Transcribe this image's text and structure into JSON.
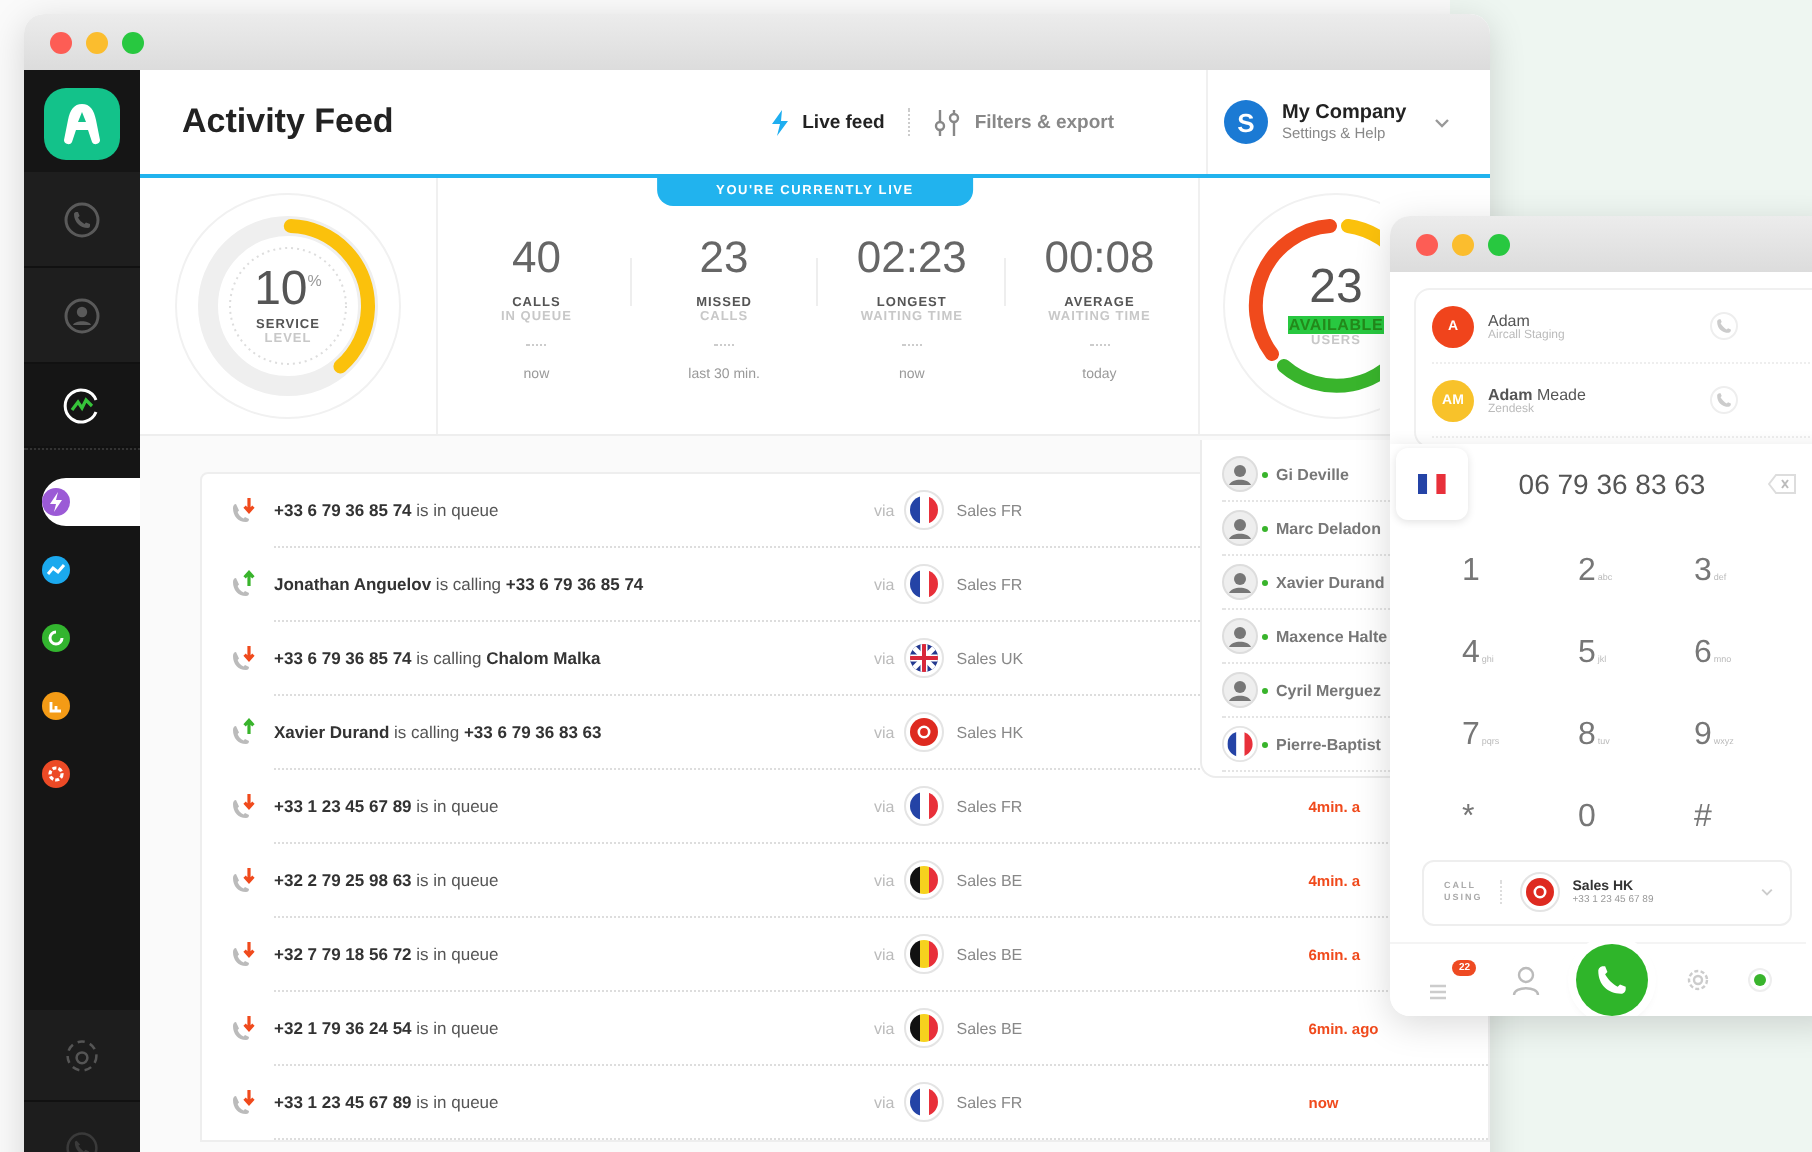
{
  "sidebar": {
    "nav": [
      {
        "kind": "phone",
        "selected": false
      },
      {
        "kind": "person",
        "selected": false
      },
      {
        "kind": "activity",
        "selected": true
      }
    ],
    "sub_items": [
      {
        "kind": "bolt",
        "color": "#9b5ad6",
        "selected": true
      },
      {
        "kind": "trend",
        "color": "#1ba9ee",
        "selected": false
      },
      {
        "kind": "refresh",
        "color": "#33b52f",
        "selected": false
      },
      {
        "kind": "chart",
        "color": "#f49b16",
        "selected": false
      },
      {
        "kind": "gear",
        "color": "#ec4a26",
        "selected": false
      }
    ]
  },
  "header": {
    "title": "Activity Feed",
    "tabs": [
      {
        "kind": "live",
        "label": "Live feed",
        "selected": true
      },
      {
        "kind": "filters",
        "label": "Filters & export",
        "selected": false
      }
    ],
    "account": {
      "initial": "S",
      "name": "My Company",
      "subtitle": "Settings & Help"
    }
  },
  "live_banner": "YOU'RE CURRENTLY LIVE",
  "service_level": {
    "value": "10",
    "unit": "%",
    "label_1": "SERVICE",
    "label_2": "LEVEL",
    "level": 0.38
  },
  "stats": [
    {
      "value": "40",
      "label_1": "CALLS",
      "label_2": "IN QUEUE",
      "period": "now"
    },
    {
      "value": "23",
      "label_1": "MISSED",
      "label_2": "CALLS",
      "period": "last 30 min."
    },
    {
      "value": "02:23",
      "label_1": "LONGEST",
      "label_2": "WAITING TIME",
      "period": "now"
    },
    {
      "value": "00:08",
      "label_1": "AVERAGE",
      "label_2": "WAITING TIME",
      "period": "today"
    }
  ],
  "availability": {
    "value": "23",
    "label_1": "AVAILABLE",
    "label_2": "USERS"
  },
  "feed": {
    "rows": [
      {
        "kind": "incoming",
        "text": "**+33 6 79 36 85 74** is in queue",
        "via": "via",
        "flag": {
          "kind": "fr"
        },
        "team": "Sales FR"
      },
      {
        "kind": "outgoing",
        "text": "**Jonathan Anguelov** is calling **+33 6 79 36 85 74**",
        "via": "via",
        "flag": {
          "kind": "fr"
        },
        "team": "Sales FR"
      },
      {
        "kind": "incoming",
        "text": "**+33 6 79 36 85 74** is calling **Chalom Malka**",
        "via": "via",
        "flag": {
          "kind": "uk"
        },
        "team": "Sales UK"
      },
      {
        "kind": "outgoing",
        "text": "**Xavier Durand** is calling **+33 6 79 36 83 63**",
        "via": "via",
        "flag": {
          "kind": "hk"
        },
        "team": "Sales HK"
      },
      {
        "kind": "incoming",
        "text": "**+33 1 23 45 67 89** is in queue",
        "via": "via",
        "flag": {
          "kind": "fr"
        },
        "team": "Sales FR",
        "time": "4min. a"
      },
      {
        "kind": "incoming",
        "text": "**+32 2 79 25 98 63** is in queue",
        "via": "via",
        "flag": {
          "kind": "be"
        },
        "team": "Sales BE",
        "time": "4min. a"
      },
      {
        "kind": "incoming",
        "text": "**+32 7 79 18 56 72** is in queue",
        "via": "via",
        "flag": {
          "kind": "be"
        },
        "team": "Sales BE",
        "time": "6min. a"
      },
      {
        "kind": "incoming",
        "text": "**+32 1 79 36 24 54** is in queue",
        "via": "via",
        "flag": {
          "kind": "be"
        },
        "team": "Sales BE",
        "time": "6min. ago"
      },
      {
        "kind": "incoming",
        "text": "**+33 1 23 45 67 89** is in queue",
        "via": "via",
        "flag": {
          "kind": "fr"
        },
        "team": "Sales FR",
        "time": "now"
      }
    ]
  },
  "users": [
    {
      "name": "Gi Deville",
      "kind": "person"
    },
    {
      "name": "Marc Deladon",
      "kind": "person"
    },
    {
      "name": "Xavier Durand",
      "kind": "person"
    },
    {
      "name": "Maxence Halte",
      "kind": "person"
    },
    {
      "name": "Cyril Merguez",
      "kind": "person"
    },
    {
      "name": "Pierre-Baptist",
      "kind": "flag"
    }
  ],
  "dialer": {
    "contacts": [
      {
        "initials": "A",
        "color": "#f0441c",
        "name": "Adam",
        "company": "Aircall Staging"
      },
      {
        "initials": "AM",
        "color": "#f8c22a",
        "name": "**Adam** Meade",
        "company": "Zendesk"
      }
    ],
    "flag": {
      "kind": "fr"
    },
    "number": "06 79 36 83 63",
    "keys": [
      {
        "digit": "1"
      },
      {
        "digit": "2",
        "letters": "abc"
      },
      {
        "digit": "3",
        "letters": "def"
      },
      {
        "digit": "4",
        "letters": "ghi"
      },
      {
        "digit": "5",
        "letters": "jkl"
      },
      {
        "digit": "6",
        "letters": "mno"
      },
      {
        "digit": "7",
        "letters": "pqrs"
      },
      {
        "digit": "8",
        "letters": "tuv"
      },
      {
        "digit": "9",
        "letters": "wxyz"
      },
      {
        "digit": "*"
      },
      {
        "digit": "0"
      },
      {
        "digit": "#"
      }
    ],
    "call_using": {
      "label_1": "CALL",
      "label_2": "USING",
      "flag": {
        "kind": "hk"
      },
      "name": "Sales HK",
      "number": "+33 1 23 45 67 89"
    },
    "badge": "22"
  }
}
